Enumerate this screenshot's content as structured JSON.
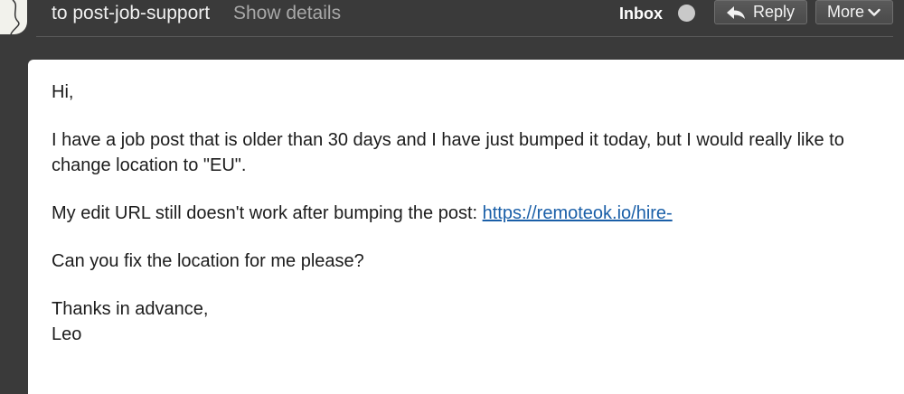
{
  "header": {
    "recipient": "to post-job-support",
    "show_details": "Show details",
    "folder": "Inbox",
    "reply_label": "Reply",
    "more_label": "More"
  },
  "icons": {
    "avatar": "avatar",
    "status": "status-dot-icon",
    "reply": "reply-arrow-icon",
    "more": "chevron-down-icon"
  },
  "colors": {
    "background": "#3a3a3a",
    "link": "#1a5fa8",
    "card": "#ffffff"
  },
  "message": {
    "greeting": "Hi,",
    "paragraph1": "I have a job post that is older than 30 days and I have just bumped it today, but I would really like to change location to \"EU\".",
    "paragraph2_text": "My edit URL still doesn't work after bumping the post: ",
    "paragraph2_link": "https://remoteok.io/hire-",
    "paragraph3": "Can you fix the location for me please?",
    "closing": "Thanks in advance,",
    "signature": "Leo"
  }
}
